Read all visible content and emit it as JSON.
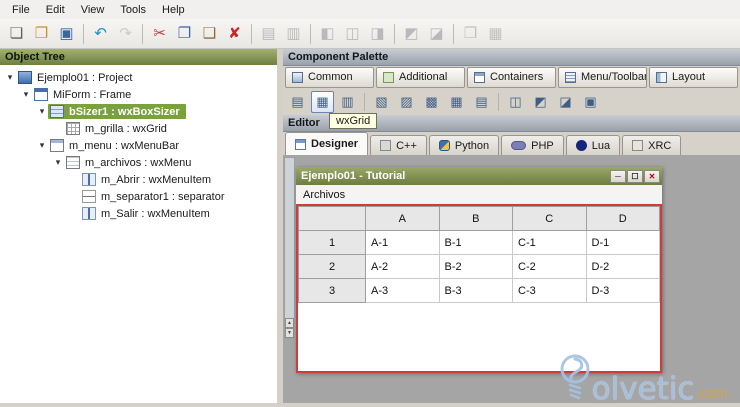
{
  "menubar": {
    "items": [
      "File",
      "Edit",
      "View",
      "Tools",
      "Help"
    ]
  },
  "toolbar": {
    "items": [
      {
        "name": "new-file",
        "glyph": "❏",
        "color": "#5f5f5f"
      },
      {
        "name": "open-folder",
        "glyph": "❒",
        "color": "#c8922f"
      },
      {
        "name": "save",
        "glyph": "▣",
        "color": "#3c66a0"
      },
      {
        "sep": true
      },
      {
        "name": "undo",
        "glyph": "↶",
        "color": "#1f8fc0"
      },
      {
        "name": "redo",
        "glyph": "↷",
        "color": "#8f8f8f",
        "disabled": true
      },
      {
        "sep": true
      },
      {
        "name": "cut",
        "glyph": "✂",
        "color": "#c03a3a"
      },
      {
        "name": "copy",
        "glyph": "❐",
        "color": "#3c66a0"
      },
      {
        "name": "paste",
        "glyph": "❑",
        "color": "#8a6d3b"
      },
      {
        "name": "delete",
        "glyph": "✘",
        "color": "#cc2222"
      },
      {
        "sep": true
      },
      {
        "name": "expand",
        "glyph": "▤",
        "color": "#4a6a90",
        "disabled": true
      },
      {
        "name": "stretch",
        "glyph": "▥",
        "color": "#4a6a90",
        "disabled": true
      },
      {
        "sep": true
      },
      {
        "name": "align-left",
        "glyph": "◧",
        "color": "#4a6a90",
        "disabled": true
      },
      {
        "name": "align-center",
        "glyph": "◫",
        "color": "#4a6a90",
        "disabled": true
      },
      {
        "name": "align-right",
        "glyph": "◨",
        "color": "#4a6a90",
        "disabled": true
      },
      {
        "sep": true
      },
      {
        "name": "border-left",
        "glyph": "◩",
        "color": "#4a6a90",
        "disabled": true
      },
      {
        "name": "border-right",
        "glyph": "◪",
        "color": "#4a6a90",
        "disabled": true
      },
      {
        "sep": true
      },
      {
        "name": "preview-window",
        "glyph": "❒",
        "color": "#777777",
        "disabled": true
      },
      {
        "name": "window-list",
        "glyph": "▦",
        "color": "#777777",
        "disabled": true
      }
    ]
  },
  "object_tree": {
    "title": "Object Tree",
    "nodes": [
      {
        "label": "Ejemplo01 : Project",
        "level": 0,
        "icon": "project-icon",
        "expanded": true
      },
      {
        "label": "MiForm : Frame",
        "level": 1,
        "icon": "frame-icon",
        "expanded": true
      },
      {
        "label": "bSizer1 : wxBoxSizer",
        "level": 2,
        "icon": "sizer-icon",
        "expanded": true,
        "selected": true
      },
      {
        "label": "m_grilla : wxGrid",
        "level": 3,
        "icon": "grid-icon"
      },
      {
        "label": "m_menu : wxMenuBar",
        "level": 2,
        "icon": "menubar-icon",
        "expanded": true
      },
      {
        "label": "m_archivos : wxMenu",
        "level": 3,
        "icon": "menu-icon",
        "expanded": true
      },
      {
        "label": "m_Abrir : wxMenuItem",
        "level": 4,
        "icon": "menuitem-icon"
      },
      {
        "label": "m_separator1 : separator",
        "level": 4,
        "icon": "separator-icon"
      },
      {
        "label": "m_Salir : wxMenuItem",
        "level": 4,
        "icon": "menuitem-icon"
      }
    ]
  },
  "component_palette": {
    "title": "Component Palette",
    "tooltip": "wxGrid",
    "tabs": [
      {
        "label": "Common",
        "icon": "common-icon"
      },
      {
        "label": "Additional",
        "icon": "additional-icon"
      },
      {
        "label": "Containers",
        "icon": "containers-icon"
      },
      {
        "label": "Menu/Toolbar",
        "icon": "menu-toolbar-icon"
      },
      {
        "label": "Layout",
        "icon": "layout-icon"
      }
    ],
    "items": [
      {
        "name": "scrolledwindow-icon",
        "glyph": "▤"
      },
      {
        "name": "wxgrid-icon",
        "glyph": "▦",
        "hovered": true
      },
      {
        "name": "propertygrid-icon",
        "glyph": "▥"
      },
      {
        "sep": true
      },
      {
        "name": "listbox-icon",
        "glyph": "▧"
      },
      {
        "name": "listctrl-icon",
        "glyph": "▨"
      },
      {
        "name": "treectrl-icon",
        "glyph": "▩"
      },
      {
        "name": "choice-icon",
        "glyph": "▦"
      },
      {
        "name": "notebook-icon",
        "glyph": "▤"
      },
      {
        "sep": true
      },
      {
        "name": "toolbar-ctrl-icon",
        "glyph": "◫"
      },
      {
        "name": "statusbar-icon",
        "glyph": "◩"
      },
      {
        "name": "menubar-ctrl-icon",
        "glyph": "◪"
      },
      {
        "name": "panel-icon",
        "glyph": "▣"
      }
    ]
  },
  "editor": {
    "title": "Editor",
    "tabs": [
      {
        "label": "Designer",
        "icon": "designer-icon",
        "active": true
      },
      {
        "label": "C++",
        "icon": "cpp-icon"
      },
      {
        "label": "Python",
        "icon": "python-icon"
      },
      {
        "label": "PHP",
        "icon": "php-icon"
      },
      {
        "label": "Lua",
        "icon": "lua-icon"
      },
      {
        "label": "XRC",
        "icon": "xrc-icon"
      }
    ]
  },
  "designer": {
    "frame_title": "Ejemplo01 - Tutorial",
    "menu_label": "Archivos",
    "grid": {
      "col_headers": [
        "A",
        "B",
        "C",
        "D"
      ],
      "rows": [
        {
          "label": "1",
          "cells": [
            "A-1",
            "B-1",
            "C-1",
            "D-1"
          ]
        },
        {
          "label": "2",
          "cells": [
            "A-2",
            "B-2",
            "C-2",
            "D-2"
          ]
        },
        {
          "label": "3",
          "cells": [
            "A-3",
            "B-3",
            "C-3",
            "D-3"
          ]
        }
      ]
    }
  },
  "watermark": {
    "text": "olvetic",
    "suffix": ".com"
  },
  "colors": {
    "selection_green": "#7aa13e",
    "frame_title_green": "#6d7d40",
    "selection_border_red": "#d03c3c",
    "tooltip_bg": "#ffffe1"
  }
}
